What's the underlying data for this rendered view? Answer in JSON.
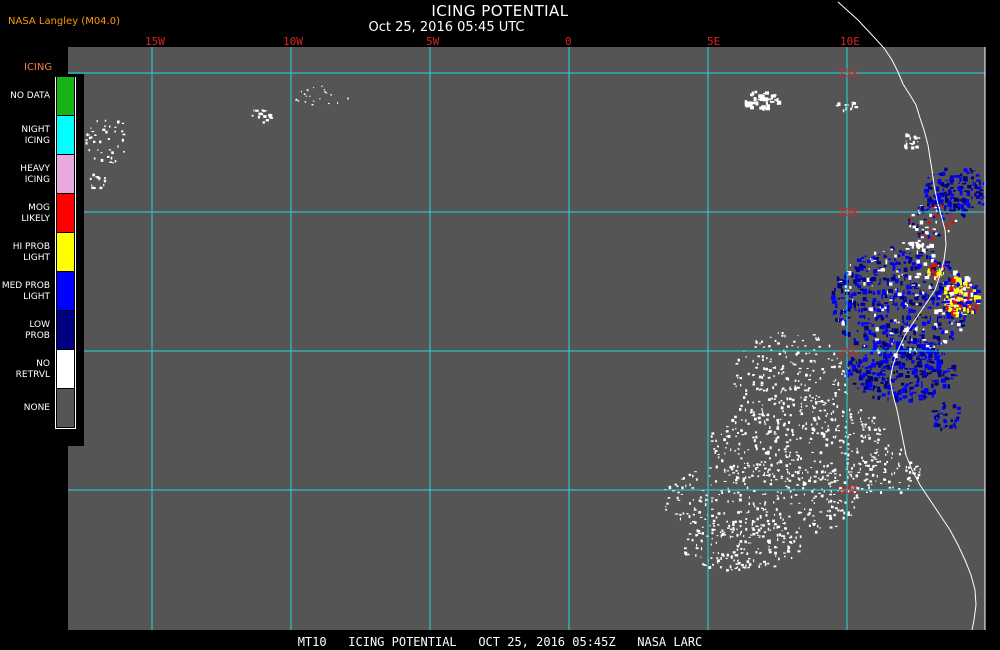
{
  "header": {
    "agency": "NASA Langley (M04.0)",
    "title": "ICING POTENTIAL",
    "subtitle": "Oct 25, 2016 05:45 UTC"
  },
  "legend": {
    "title": "ICING",
    "items": [
      {
        "label": "NO DATA",
        "color": "#18b318"
      },
      {
        "label": "NIGHT ICING",
        "color": "#00ffff"
      },
      {
        "label": "HEAVY ICING",
        "color": "#e8a8e0"
      },
      {
        "label": "MOG LIKELY",
        "color": "#ff0000"
      },
      {
        "label": "HI PROB LIGHT",
        "color": "#ffff00"
      },
      {
        "label": "MED PROB LIGHT",
        "color": "#0000ff"
      },
      {
        "label": "LOW PROB",
        "color": "#000080"
      },
      {
        "label": "NO RETRVL",
        "color": "#ffffff"
      },
      {
        "label": "NONE",
        "color": "#555555"
      }
    ]
  },
  "grid": {
    "lon_labels": [
      "15W",
      "10W",
      "5W",
      "0",
      "5E",
      "10E"
    ],
    "lat_labels": [
      "15S",
      "20S",
      "25S",
      "30S"
    ],
    "line_color": "#22d6e8",
    "background_color": "#555555",
    "coast_color": "#ffffff"
  },
  "footer": "MT10   ICING POTENTIAL   OCT 25, 2016 05:45Z   NASA LARC"
}
